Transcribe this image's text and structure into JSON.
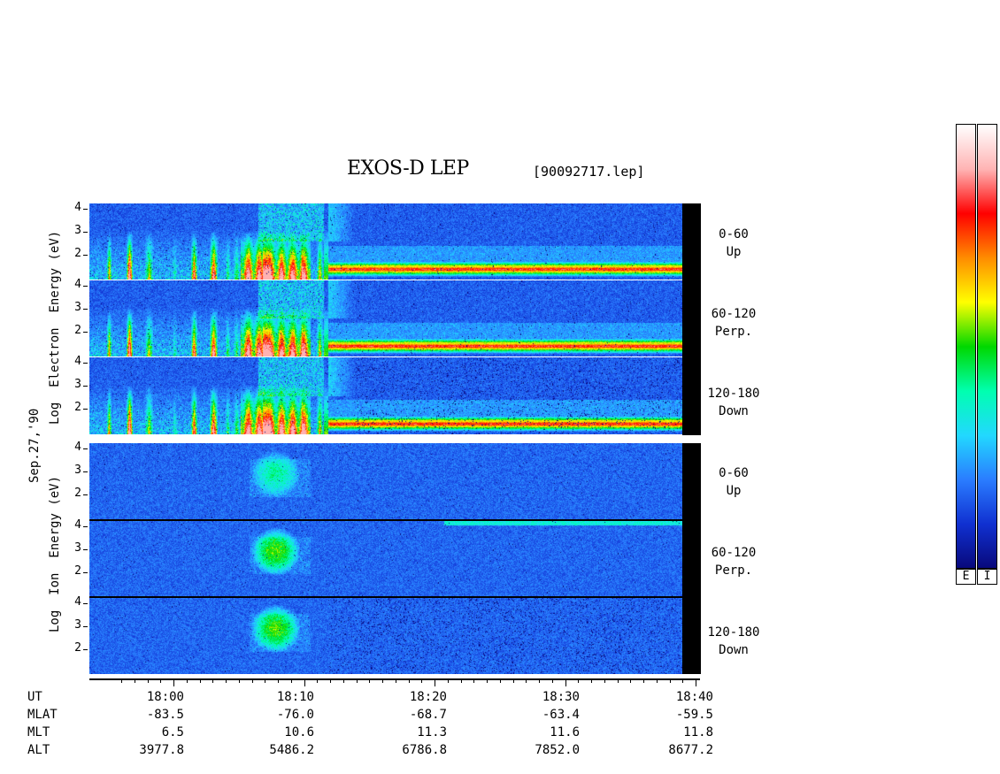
{
  "header": {
    "title": "EXOS-D LEP",
    "file": "[90092717.lep]"
  },
  "date_label": "Sep.27,'90",
  "electron_label": {
    "line1": "Log",
    "line2": "Electron",
    "line3": "Energy",
    "line4": "(eV)"
  },
  "ion_label": {
    "line1": "Log",
    "line2": "Ion",
    "line3": "Energy",
    "line4": "(eV)"
  },
  "panels": [
    {
      "range": "0-60",
      "dir": "Up"
    },
    {
      "range": "60-120",
      "dir": "Perp."
    },
    {
      "range": "120-180",
      "dir": "Down"
    },
    {
      "range": "0-60",
      "dir": "Up"
    },
    {
      "range": "60-120",
      "dir": "Perp."
    },
    {
      "range": "120-180",
      "dir": "Down"
    }
  ],
  "y_ticks": [
    "4",
    "3",
    "2"
  ],
  "x_axis": {
    "rows": [
      {
        "name": "UT",
        "values": [
          "18:00",
          "18:10",
          "18:20",
          "18:30",
          "18:40"
        ]
      },
      {
        "name": "MLAT",
        "values": [
          "-83.5",
          "-76.0",
          "-68.7",
          "-63.4",
          "-59.5"
        ]
      },
      {
        "name": "MLT",
        "values": [
          "6.5",
          "10.6",
          "11.3",
          "11.6",
          "11.8"
        ]
      },
      {
        "name": "ALT",
        "values": [
          "3977.8",
          "5486.2",
          "6786.8",
          "7852.0",
          "8677.2"
        ]
      }
    ]
  },
  "colorbar": {
    "labels": [
      "E",
      "I"
    ]
  },
  "chart_data": {
    "type": "heatmap",
    "title": "EXOS-D LEP",
    "subtitle": "[90092717.lep]",
    "xlabel": "UT",
    "x_ticks": [
      "18:00",
      "18:10",
      "18:20",
      "18:30",
      "18:40"
    ],
    "ylim_log_energy_eV": [
      1,
      4
    ],
    "y_ticks": [
      "4",
      "3",
      "2"
    ],
    "panels": [
      {
        "species": "Electron",
        "pitch_angle": "0-60",
        "direction": "Up"
      },
      {
        "species": "Electron",
        "pitch_angle": "60-120",
        "direction": "Perp."
      },
      {
        "species": "Electron",
        "pitch_angle": "120-180",
        "direction": "Down"
      },
      {
        "species": "Ion",
        "pitch_angle": "0-60",
        "direction": "Up"
      },
      {
        "species": "Ion",
        "pitch_angle": "60-120",
        "direction": "Perp."
      },
      {
        "species": "Ion",
        "pitch_angle": "120-180",
        "direction": "Down"
      }
    ],
    "colormap": [
      "#08087a",
      "#1030d0",
      "#2a7cff",
      "#22d8ff",
      "#00ffb0",
      "#00d800",
      "#ffff00",
      "#ff8c00",
      "#ff0000",
      "#ffb4b4",
      "#ffffff"
    ],
    "colors": {
      "background": "#ffffff",
      "data_end_fill": "#000000"
    }
  }
}
